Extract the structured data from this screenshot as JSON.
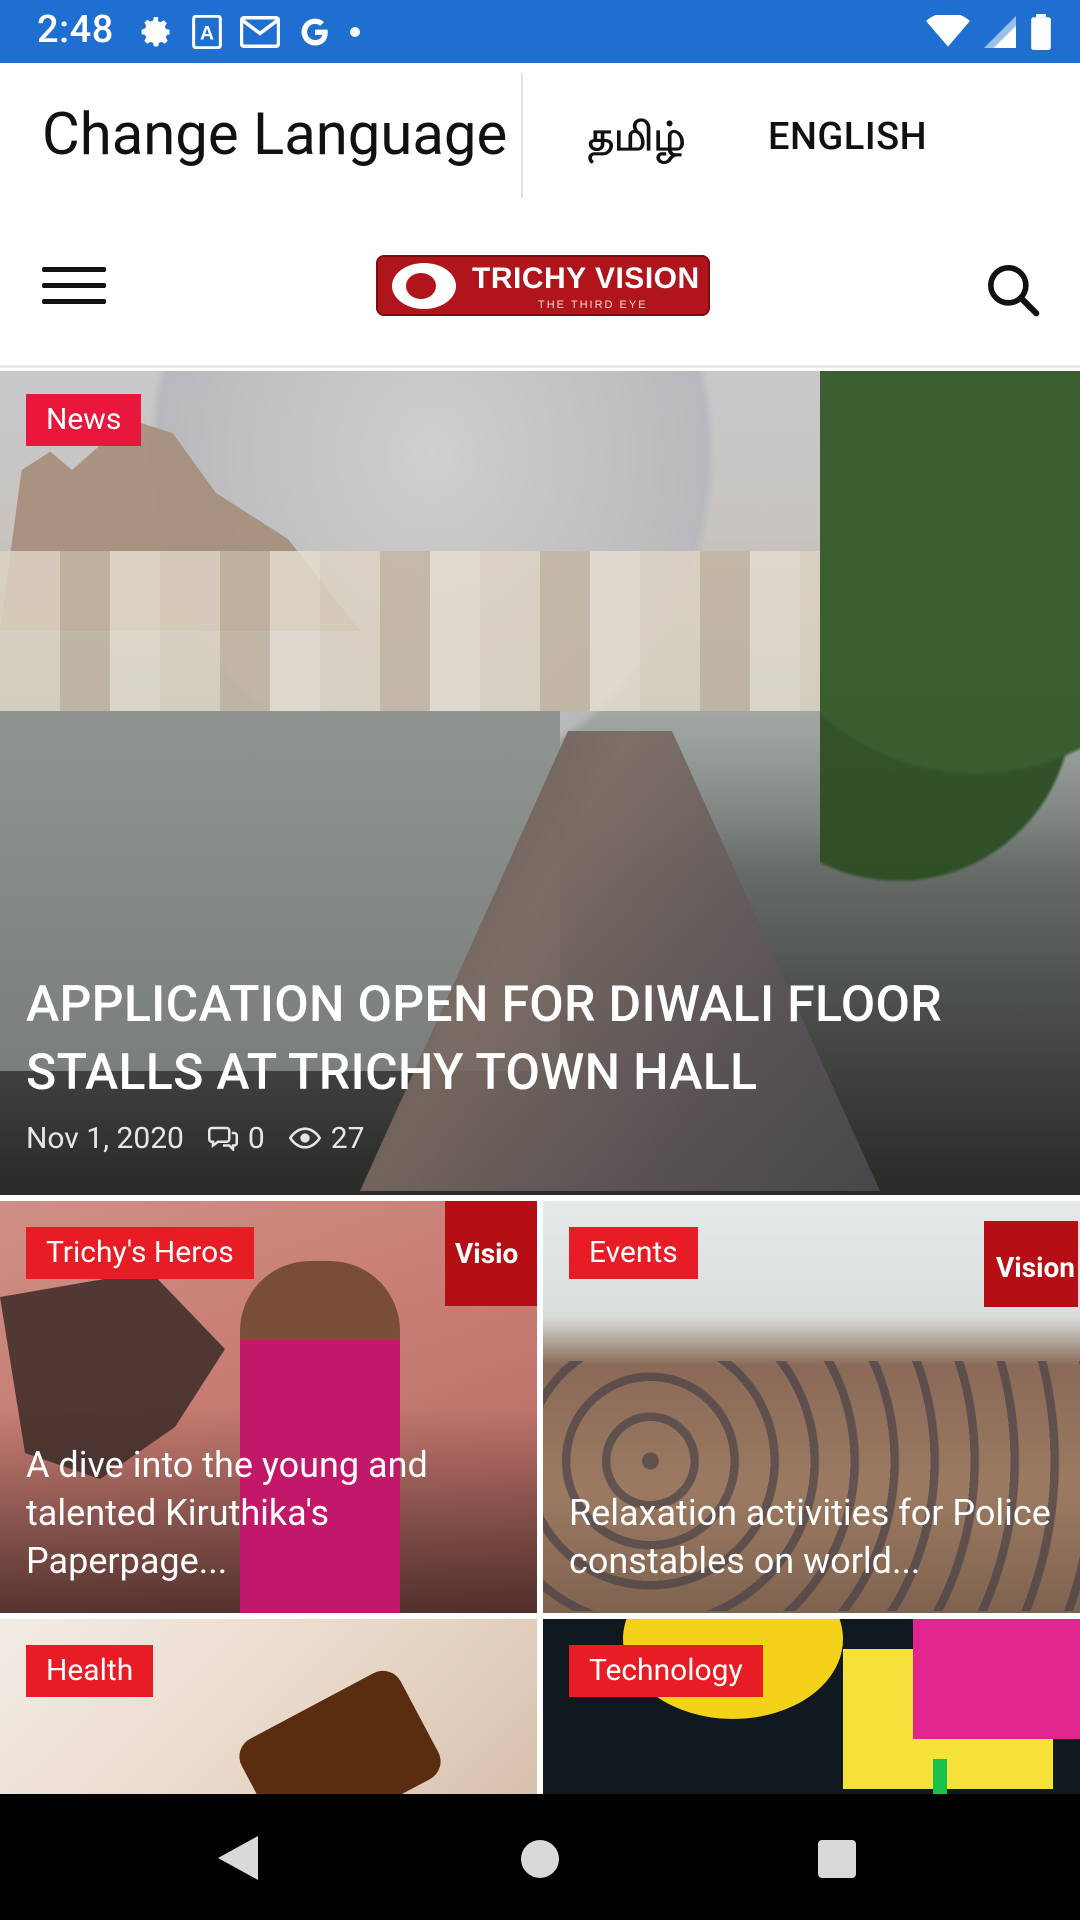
{
  "status_bar": {
    "time": "2:48",
    "icons_left": [
      "settings-icon",
      "font-a-icon",
      "gmail-icon",
      "google-icon",
      "dot-icon"
    ],
    "icons_right": [
      "wifi-icon",
      "signal-icon",
      "battery-icon"
    ]
  },
  "language_bar": {
    "label": "Change Language",
    "options": [
      {
        "label": "தமிழ்"
      },
      {
        "label": "ENGLISH"
      }
    ]
  },
  "header": {
    "logo_text": "TRICHY VISION",
    "logo_tagline": "THE THIRD EYE",
    "icons": [
      "hamburger-menu-icon",
      "search-icon"
    ]
  },
  "hero": {
    "category": "News",
    "title": "APPLICATION OPEN FOR DIWALI FLOOR STALLS AT TRICHY TOWN HALL",
    "date": "Nov 1, 2020",
    "comments": "0",
    "views": "27"
  },
  "cards": [
    {
      "category": "Trichy's Heros",
      "title": "A dive into the young and talented Kiruthika's Paperpage...",
      "watermark": "Visio"
    },
    {
      "category": "Events",
      "title": "Relaxation activities for Police constables on world...",
      "watermark": "Vision"
    },
    {
      "category": "Health",
      "title": ""
    },
    {
      "category": "Technology",
      "title": ""
    }
  ],
  "colors": {
    "status_bar": "#1f6fd1",
    "tag_red": "#e8173b",
    "logo_red": "#b0151c",
    "nav_bar": "#000000"
  },
  "nav_bar": {
    "buttons": [
      "back-icon",
      "home-icon",
      "recents-icon"
    ]
  }
}
